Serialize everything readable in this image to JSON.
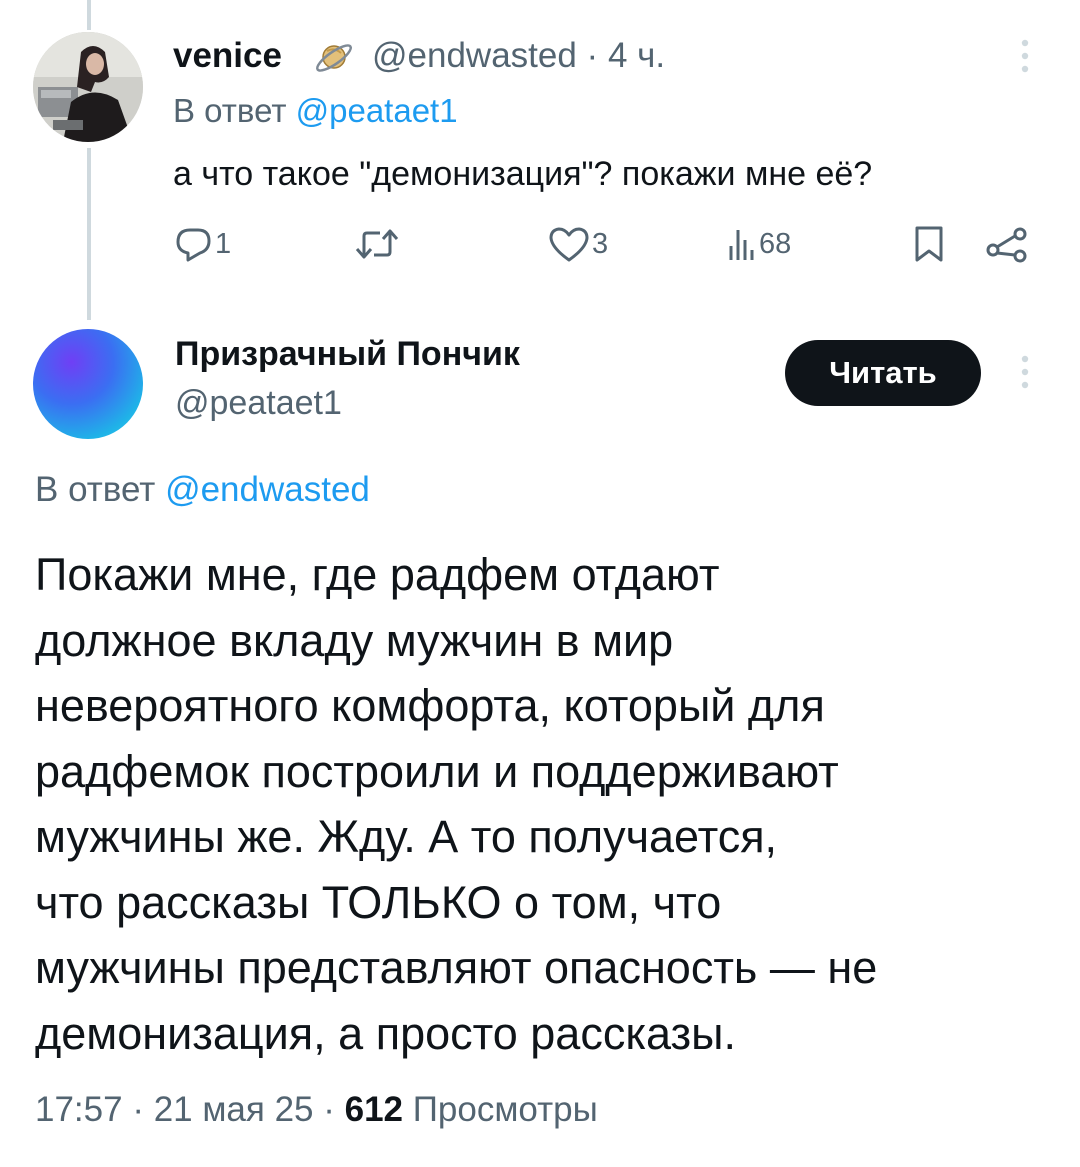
{
  "reply_tweet": {
    "display_name": "venice",
    "name_emoji_icon": "ringed-planet-emoji",
    "handle": "@endwasted",
    "time_sep": " · ",
    "time": "4 ч.",
    "reply_prefix": "В ответ ",
    "reply_mention": "@peataet1",
    "text": "а что такое \"демонизация\"? покажи мне её?",
    "actions": {
      "replies": "1",
      "retweets": "",
      "likes": "3",
      "views": "68"
    },
    "icons": [
      "reply-icon",
      "retweet-icon",
      "like-icon",
      "views-icon",
      "bookmark-icon",
      "share-icon",
      "more-icon"
    ]
  },
  "main_tweet": {
    "display_name": "Призрачный Пончик",
    "handle": "@peataet1",
    "follow_label": "Читать",
    "reply_prefix": "В ответ ",
    "reply_mention": "@endwasted",
    "text_lines": [
      "Покажи мне, где радфем отдают",
      "должное вкладу мужчин в мир",
      "невероятного комфорта, который для",
      "радфемок построили и поддерживают",
      "мужчины же. Жду. А то получается,",
      "что рассказы ТОЛЬКО о том, что",
      "мужчины представляют опасность — не",
      "демонизация, а просто рассказы."
    ],
    "meta": {
      "time": "17:57",
      "sep1": " · ",
      "date": "21 мая 25",
      "sep2": " · ",
      "views_count": "612",
      "views_label": " Просмотры"
    }
  },
  "colors": {
    "text": "#0f1419",
    "secondary": "#536471",
    "link": "#1d9bf0",
    "button_bg": "#0f1419"
  }
}
